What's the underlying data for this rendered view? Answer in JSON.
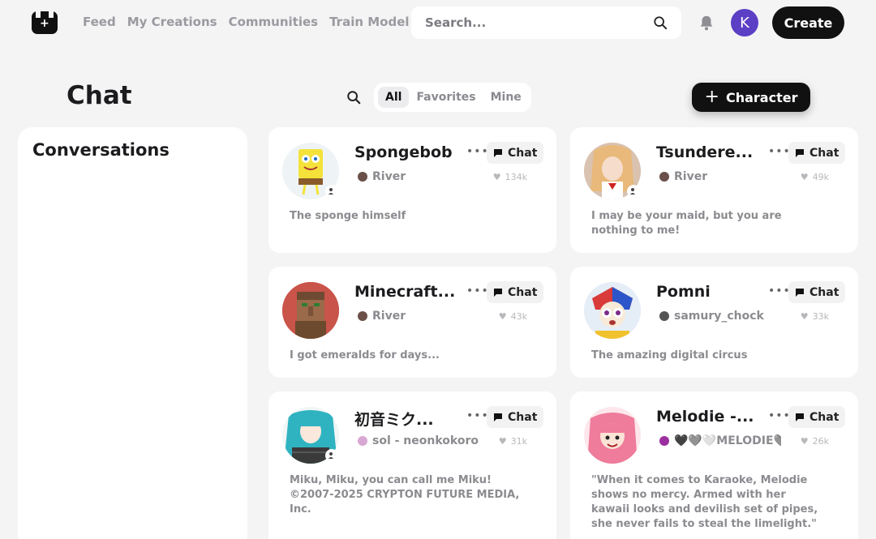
{
  "nav": {
    "links": [
      "Feed",
      "My Creations",
      "Communities",
      "Train Model"
    ],
    "search_placeholder": "Search...",
    "avatar_letter": "K",
    "create_label": "Create"
  },
  "header": {
    "title": "Chat",
    "tabs": [
      "All",
      "Favorites",
      "Mine"
    ],
    "active_tab": "All",
    "character_button": "Character"
  },
  "sidebar": {
    "title": "Conversations"
  },
  "cards": [
    {
      "name": "Spongebob",
      "creator": "River",
      "likes": "134k",
      "description": "The sponge himself",
      "chat_label": "Chat"
    },
    {
      "name": "Tsundere...",
      "creator": "River",
      "likes": "49k",
      "description": "I may be your maid, but you are nothing to me!",
      "chat_label": "Chat"
    },
    {
      "name": "Minecraft...",
      "creator": "River",
      "likes": "43k",
      "description": "I got emeralds for days...",
      "chat_label": "Chat"
    },
    {
      "name": "Pomni",
      "creator": "samury_chock",
      "likes": "33k",
      "description": "The amazing digital circus",
      "chat_label": "Chat"
    },
    {
      "name": "初音ミク...",
      "creator": "sol - neonkokoro",
      "likes": "31k",
      "description": "Miku, Miku, you can call me Miku! ©2007-2025 CRYPTON FUTURE MEDIA, Inc.",
      "chat_label": "Chat"
    },
    {
      "name": "Melodie -...",
      "creator": "🖤🩶🤍MELODIE🩶...",
      "likes": "26k",
      "description": "\"When it comes to Karaoke, Melodie shows no mercy. Armed with her kawaii looks and devilish set of pipes, she never fails to steal the limelight.\"",
      "chat_label": "Chat"
    }
  ]
}
